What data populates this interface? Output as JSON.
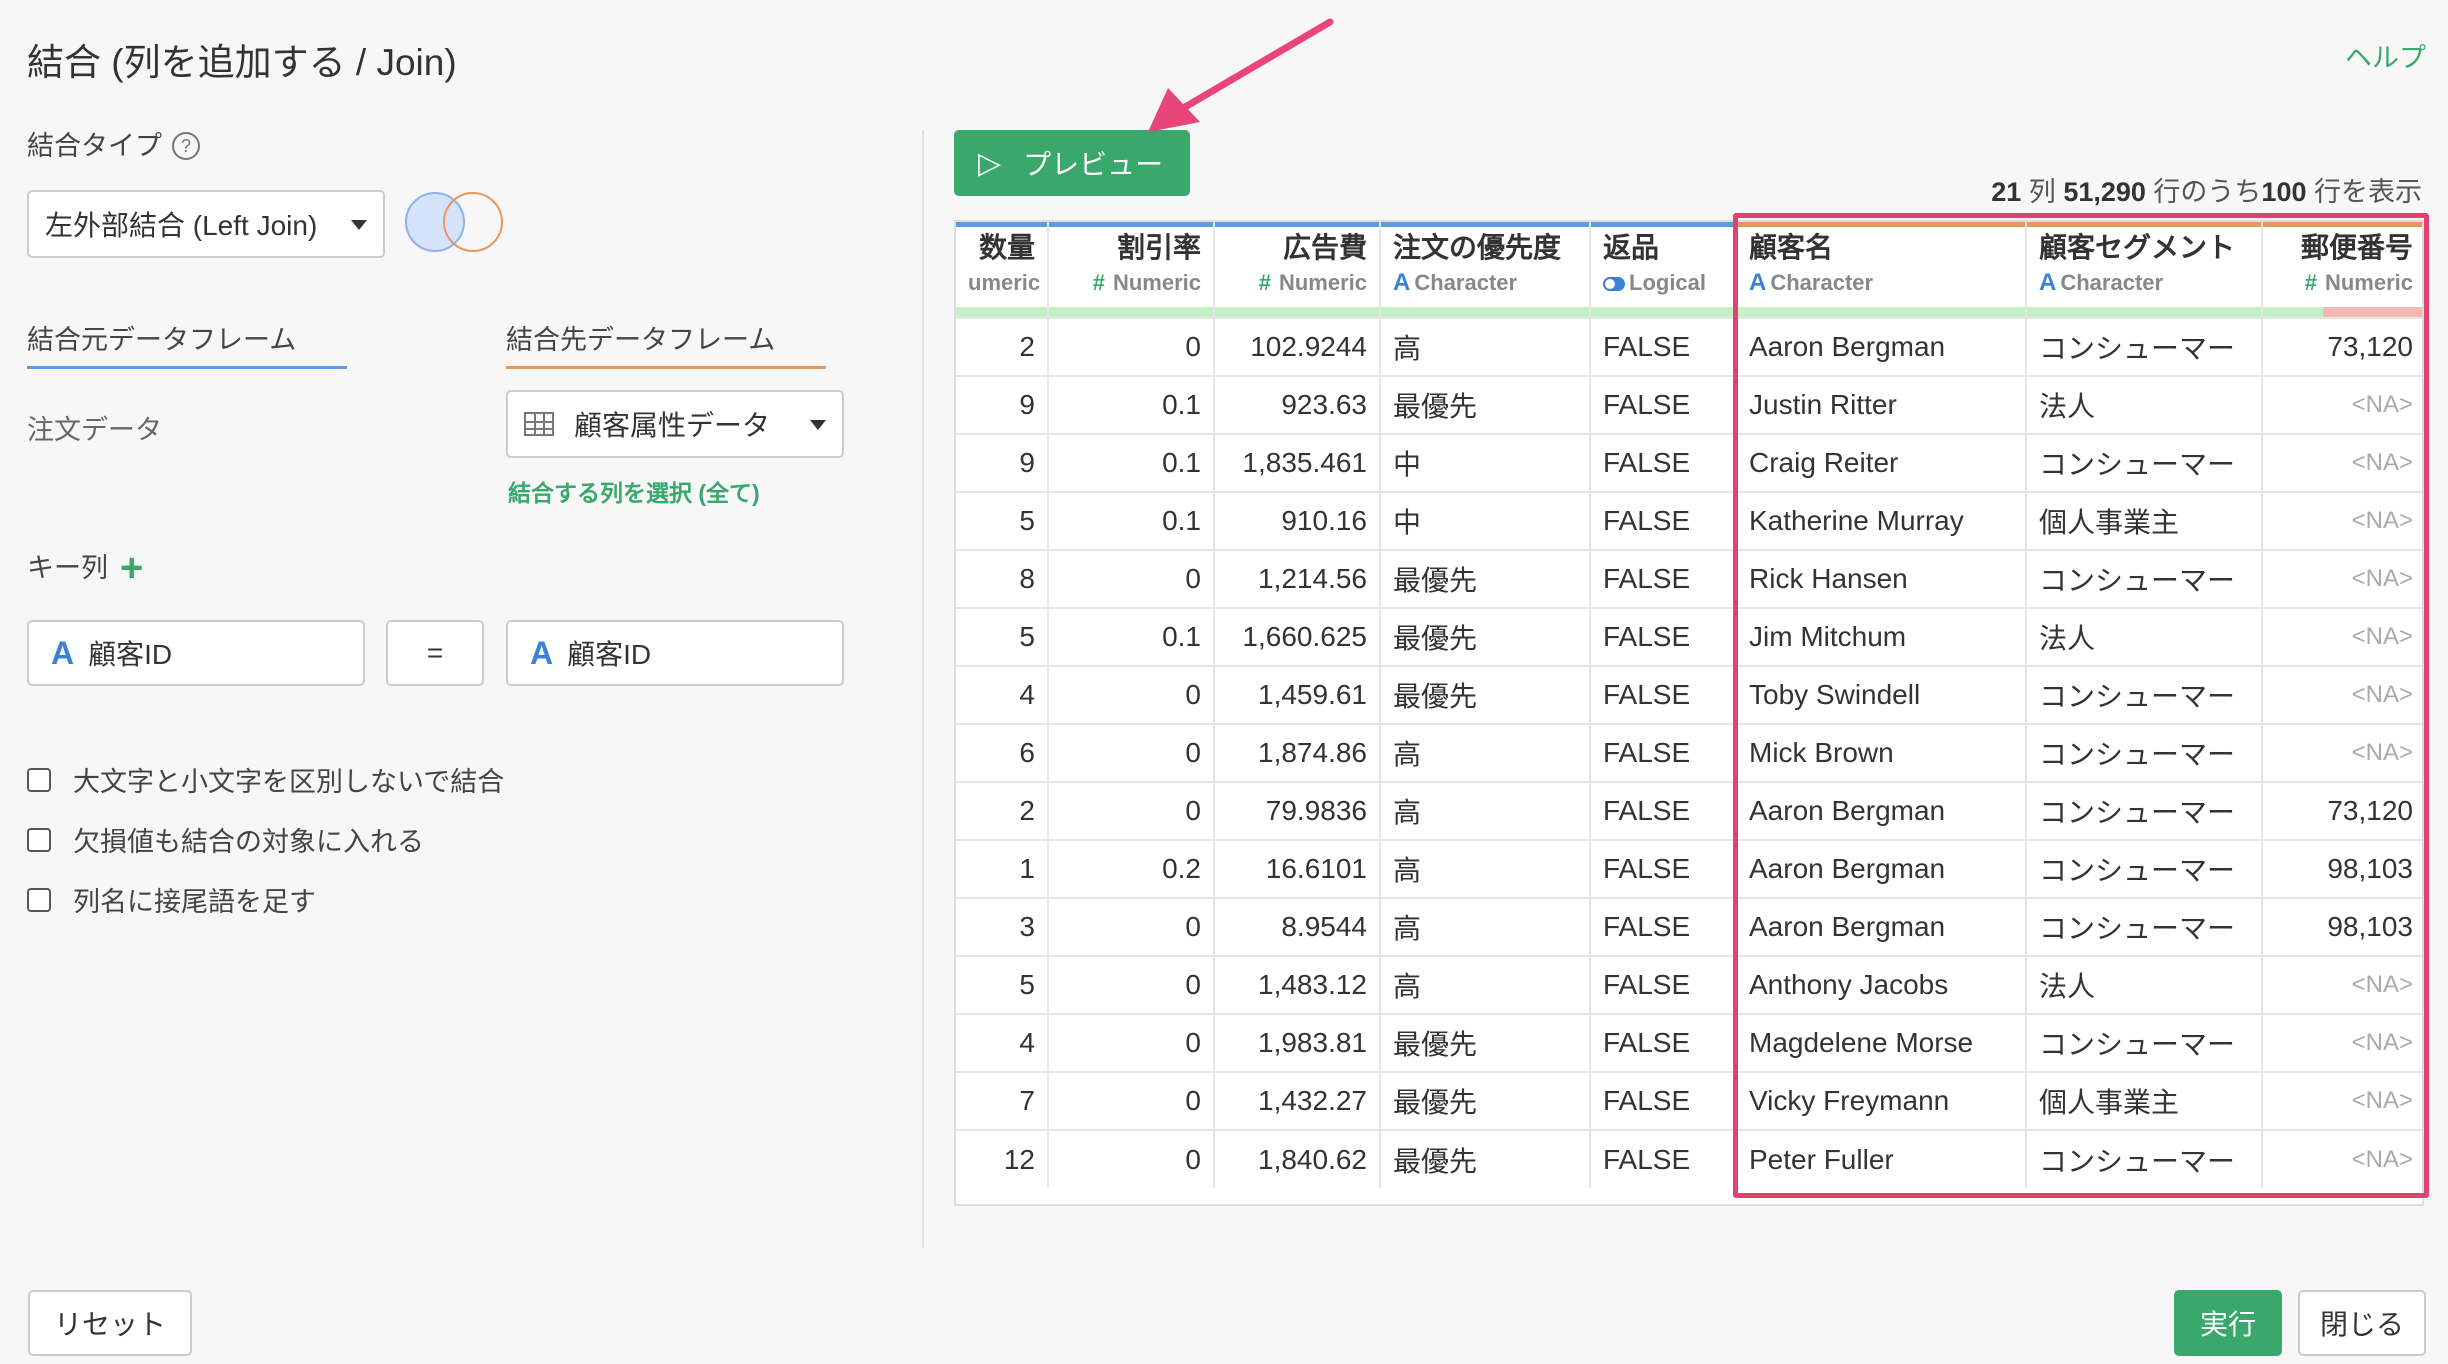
{
  "title": "結合 (列を追加する / Join)",
  "help_link": "ヘルプ",
  "join_type": {
    "label": "結合タイプ",
    "help_icon": "question-circle-icon",
    "value": "左外部結合 (Left Join)"
  },
  "source": {
    "tab_label": "結合元データフレーム",
    "value": "注文データ"
  },
  "target": {
    "tab_label": "結合先データフレーム",
    "value": "顧客属性データ",
    "select_columns_link": "結合する列を選択 (全て)"
  },
  "key": {
    "label": "キー列",
    "add_icon": "plus-icon",
    "left_type": "A",
    "left_column": "顧客ID",
    "operator": "=",
    "right_type": "A",
    "right_column": "顧客ID"
  },
  "options": [
    {
      "label": "大文字と小文字を区別しないで結合",
      "checked": false
    },
    {
      "label": "欠損値も結合の対象に入れる",
      "checked": false
    },
    {
      "label": "列名に接尾語を足す",
      "checked": false
    }
  ],
  "preview": {
    "button_label": "プレビュー",
    "summary": {
      "cols": "21",
      "cols_unit": " 列 ",
      "rows_total": "51,290",
      "rows_mid": " 行のうち",
      "rows_shown": "100",
      "rows_end": " 行を表示"
    }
  },
  "colors": {
    "accent_green": "#3aa76d",
    "source_blue": "#5b9be6",
    "target_orange": "#e8975a",
    "highlight_pink": "#e0436f"
  },
  "table": {
    "columns": [
      {
        "name": "数量",
        "type": "Numeric",
        "type_symbol": "#",
        "align": "num",
        "source": "source"
      },
      {
        "name": "割引率",
        "type": "Numeric",
        "type_symbol": "#",
        "align": "num",
        "source": "source"
      },
      {
        "name": "広告費",
        "type": "Numeric",
        "type_symbol": "#",
        "align": "num",
        "source": "source"
      },
      {
        "name": "注文の優先度",
        "type": "Character",
        "type_symbol": "A",
        "align": "txt",
        "source": "source"
      },
      {
        "name": "返品",
        "type": "Logical",
        "type_symbol": "toggle",
        "align": "txt",
        "source": "source"
      },
      {
        "name": "顧客名",
        "type": "Character",
        "type_symbol": "A",
        "align": "txt",
        "source": "target"
      },
      {
        "name": "顧客セグメント",
        "type": "Character",
        "type_symbol": "A",
        "align": "txt",
        "source": "target"
      },
      {
        "name": "郵便番号",
        "type": "Numeric",
        "type_symbol": "#",
        "align": "num",
        "source": "target"
      }
    ],
    "first_col_type_visible": "umeric",
    "rows": [
      [
        "2",
        "0",
        "102.9244",
        "高",
        "FALSE",
        "Aaron Bergman",
        "コンシューマー",
        "73,120"
      ],
      [
        "9",
        "0.1",
        "923.63",
        "最優先",
        "FALSE",
        "Justin Ritter",
        "法人",
        "<NA>"
      ],
      [
        "9",
        "0.1",
        "1,835.461",
        "中",
        "FALSE",
        "Craig Reiter",
        "コンシューマー",
        "<NA>"
      ],
      [
        "5",
        "0.1",
        "910.16",
        "中",
        "FALSE",
        "Katherine Murray",
        "個人事業主",
        "<NA>"
      ],
      [
        "8",
        "0",
        "1,214.56",
        "最優先",
        "FALSE",
        "Rick Hansen",
        "コンシューマー",
        "<NA>"
      ],
      [
        "5",
        "0.1",
        "1,660.625",
        "最優先",
        "FALSE",
        "Jim Mitchum",
        "法人",
        "<NA>"
      ],
      [
        "4",
        "0",
        "1,459.61",
        "最優先",
        "FALSE",
        "Toby Swindell",
        "コンシューマー",
        "<NA>"
      ],
      [
        "6",
        "0",
        "1,874.86",
        "高",
        "FALSE",
        "Mick Brown",
        "コンシューマー",
        "<NA>"
      ],
      [
        "2",
        "0",
        "79.9836",
        "高",
        "FALSE",
        "Aaron Bergman",
        "コンシューマー",
        "73,120"
      ],
      [
        "1",
        "0.2",
        "16.6101",
        "高",
        "FALSE",
        "Aaron Bergman",
        "コンシューマー",
        "98,103"
      ],
      [
        "3",
        "0",
        "8.9544",
        "高",
        "FALSE",
        "Aaron Bergman",
        "コンシューマー",
        "98,103"
      ],
      [
        "5",
        "0",
        "1,483.12",
        "高",
        "FALSE",
        "Anthony Jacobs",
        "法人",
        "<NA>"
      ],
      [
        "4",
        "0",
        "1,983.81",
        "最優先",
        "FALSE",
        "Magdelene Morse",
        "コンシューマー",
        "<NA>"
      ],
      [
        "7",
        "0",
        "1,432.27",
        "最優先",
        "FALSE",
        "Vicky Freymann",
        "個人事業主",
        "<NA>"
      ],
      [
        "12",
        "0",
        "1,840.62",
        "最優先",
        "FALSE",
        "Peter Fuller",
        "コンシューマー",
        "<NA>"
      ]
    ]
  },
  "footer": {
    "reset_label": "リセット",
    "run_label": "実行",
    "close_label": "閉じる"
  }
}
